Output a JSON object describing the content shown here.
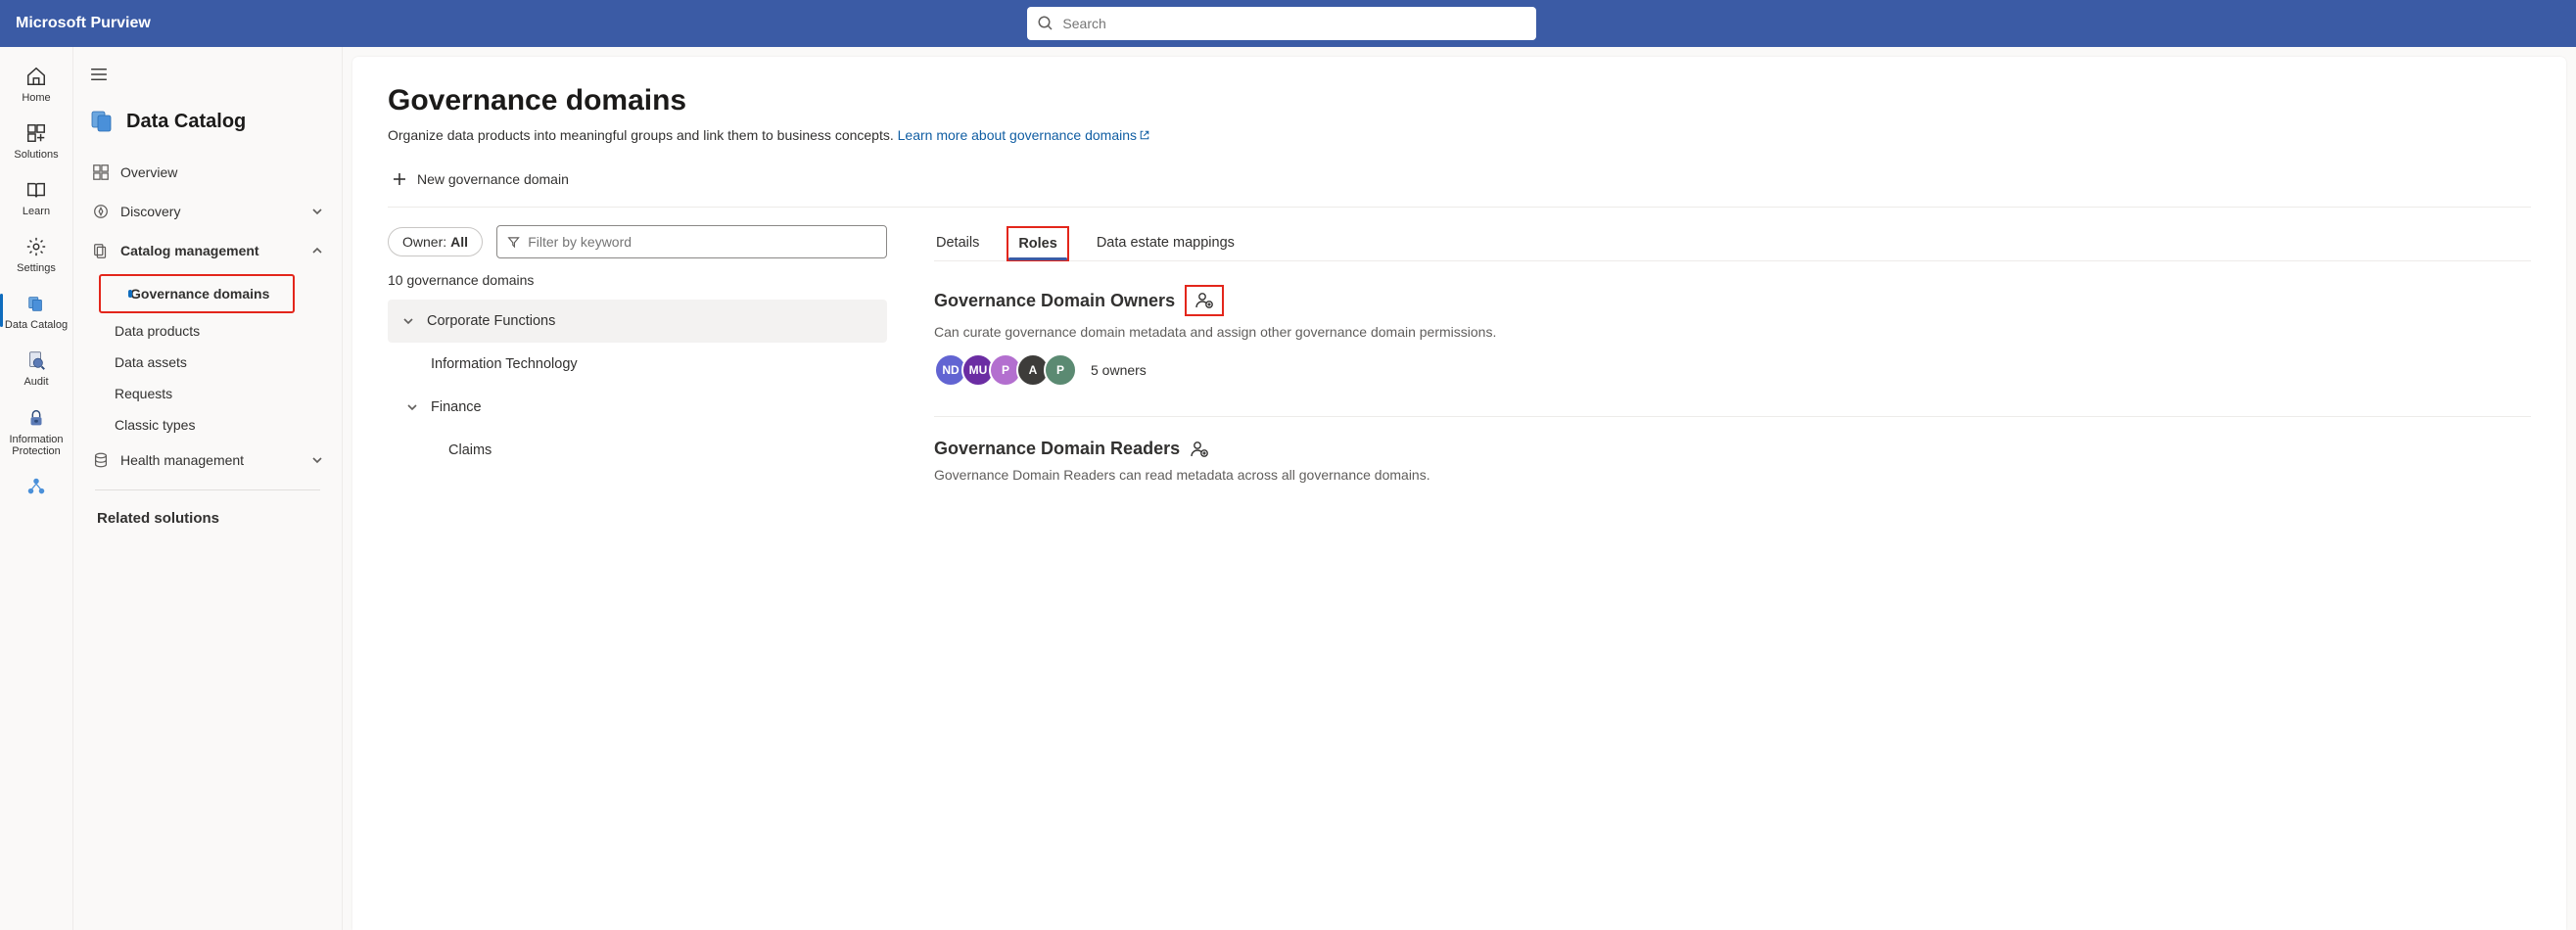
{
  "header": {
    "brand": "Microsoft Purview",
    "search_placeholder": "Search"
  },
  "rail": {
    "items": [
      {
        "key": "home",
        "label": "Home"
      },
      {
        "key": "solutions",
        "label": "Solutions"
      },
      {
        "key": "learn",
        "label": "Learn"
      },
      {
        "key": "settings",
        "label": "Settings"
      },
      {
        "key": "data-catalog",
        "label": "Data Catalog",
        "selected": true
      },
      {
        "key": "audit",
        "label": "Audit"
      },
      {
        "key": "info-protection",
        "label": "Information Protection"
      }
    ]
  },
  "nav2": {
    "module_title": "Data Catalog",
    "items": {
      "overview": "Overview",
      "discovery": "Discovery",
      "catalog_mgmt": "Catalog management",
      "gov_domains": "Governance domains",
      "data_products": "Data products",
      "data_assets": "Data assets",
      "requests": "Requests",
      "classic_types": "Classic types",
      "health_mgmt": "Health management",
      "related_heading": "Related solutions"
    }
  },
  "main": {
    "title": "Governance domains",
    "description": "Organize data products into meaningful groups and link them to business concepts.",
    "learn_more": "Learn more about governance domains",
    "new_domain_label": "New governance domain",
    "filter": {
      "owner_prefix": "Owner:",
      "owner_value": "All",
      "filter_placeholder": "Filter by keyword"
    },
    "count_text": "10 governance domains",
    "tree": {
      "corp_fn": "Corporate Functions",
      "it": "Information Technology",
      "finance": "Finance",
      "claims": "Claims"
    },
    "tabs": {
      "details": "Details",
      "roles": "Roles",
      "mappings": "Data estate mappings"
    },
    "roles": {
      "owners": {
        "title": "Governance Domain Owners",
        "desc": "Can curate governance domain metadata and assign other governance domain permissions.",
        "avatars": [
          {
            "initials": "ND",
            "color": "#6264d2"
          },
          {
            "initials": "MU",
            "color": "#6b2da3"
          },
          {
            "initials": "P",
            "color": "#b36fcf"
          },
          {
            "initials": "A",
            "color": "#3d3c3a"
          },
          {
            "initials": "P",
            "color": "#5b8a72"
          }
        ],
        "count_text": "5 owners"
      },
      "readers": {
        "title": "Governance Domain Readers",
        "desc": "Governance Domain Readers can read metadata across all governance domains."
      }
    }
  }
}
